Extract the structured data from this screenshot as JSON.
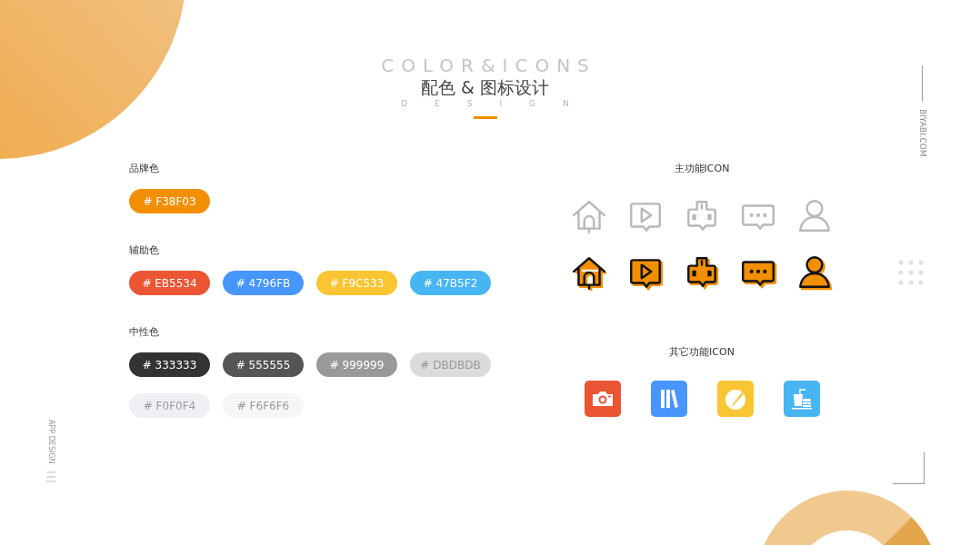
{
  "header": {
    "backdrop_title": "COLOR&ICONS",
    "backdrop_subtitle": "DESIGN",
    "title": "配色 & 图标设计"
  },
  "side_right": {
    "text": "BIYABI.COM"
  },
  "side_left": {
    "text": "APP DESIGN"
  },
  "palettes": [
    {
      "label": "品牌色",
      "swatches": [
        {
          "text": "# F38F03",
          "color": "#f38f03"
        }
      ]
    },
    {
      "label": "辅助色",
      "swatches": [
        {
          "text": "# EB5534",
          "color": "#eb5534"
        },
        {
          "text": "# 4796FB",
          "color": "#4796fb"
        },
        {
          "text": "# F9C533",
          "color": "#f9c533"
        },
        {
          "text": "# 47B5F2",
          "color": "#47b5f2"
        }
      ]
    },
    {
      "label": "中性色",
      "swatches": [
        {
          "text": "# 333333",
          "color": "#333333"
        },
        {
          "text": "# 555555",
          "color": "#555555"
        },
        {
          "text": "# 999999",
          "color": "#999999"
        },
        {
          "text": "# DBDBDB",
          "color": "#dbdbdb"
        },
        {
          "text": "# F0F0F4",
          "color": "#f0f0f4"
        },
        {
          "text": "# F6F6F6",
          "color": "#f6f6f6"
        }
      ]
    }
  ],
  "main_icons": {
    "label": "主功能ICON"
  },
  "other_icons": {
    "label": "其它功能ICON",
    "icons": [
      {
        "kind": "camera",
        "color": "#eb5534"
      },
      {
        "kind": "books",
        "color": "#4796fb"
      },
      {
        "kind": "pencil",
        "color": "#f9c533"
      },
      {
        "kind": "drink",
        "color": "#47b5f2"
      }
    ]
  }
}
